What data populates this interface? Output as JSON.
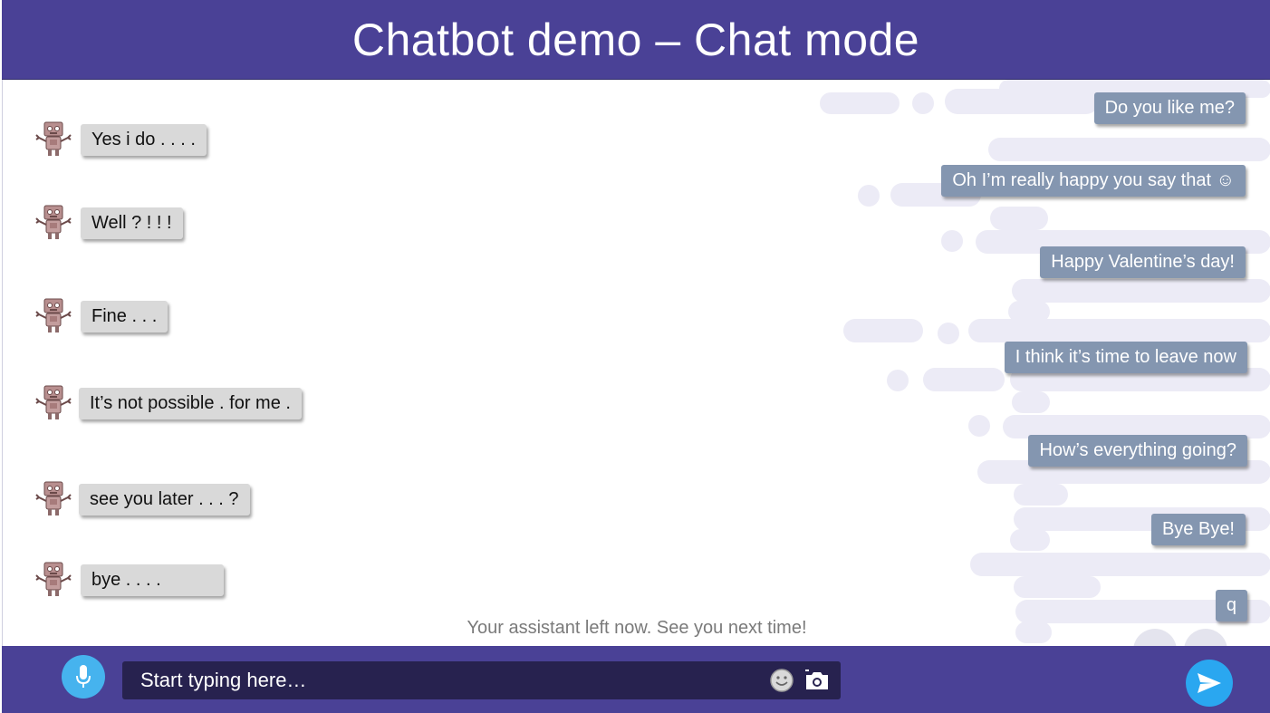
{
  "header": {
    "title": "Chatbot demo – Chat mode"
  },
  "messages": {
    "user": [
      "Do you like me?",
      "Oh I’m really happy you say that ☺",
      "Happy Valentine’s day!",
      "I think it’s time to leave now",
      "How’s everything going?",
      "Bye Bye!",
      "q"
    ],
    "bot": [
      "Yes i do . . . .",
      "Well ? ! ! !",
      "Fine . . .",
      "It’s not possible . for me .",
      "see you later . . . ?",
      "bye . . . ."
    ]
  },
  "status": {
    "text": "Your assistant left now. See you next time!"
  },
  "composer": {
    "placeholder": "Start typing here…",
    "mic_icon": "microphone-icon",
    "emoji_icon": "smiley-icon",
    "camera_icon": "camera-icon",
    "send_icon": "send-icon"
  },
  "colors": {
    "header_bg": "#4a4196",
    "user_bubble": "#8496b0",
    "bot_bubble": "#d9d9d9",
    "input_bg": "#27224f",
    "mic_bg": "#46b3ee",
    "send_bg": "#2aa7f0"
  }
}
